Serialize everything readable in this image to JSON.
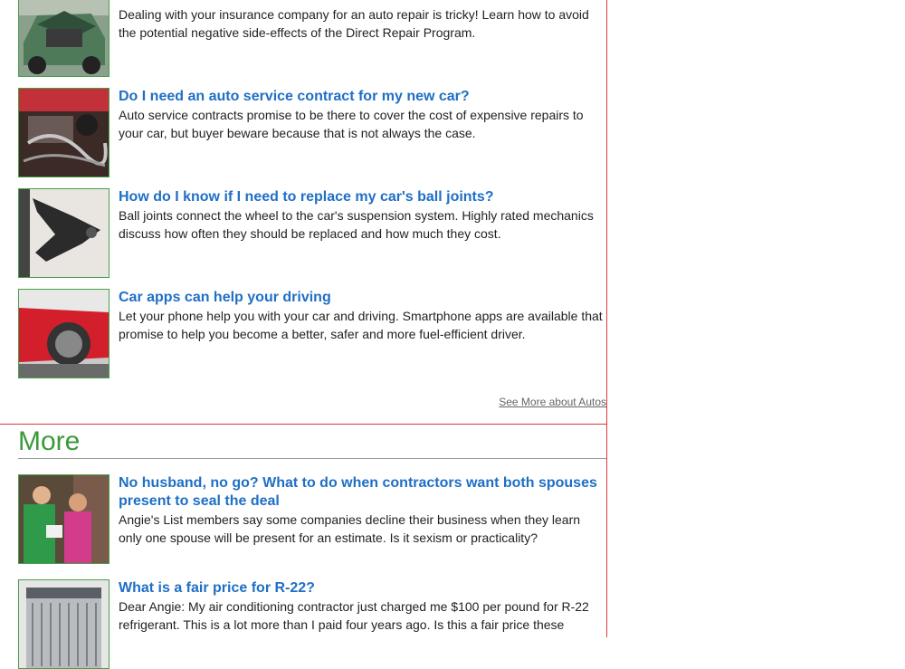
{
  "articles_top": [
    {
      "title": "",
      "description": "Dealing with your insurance company for an auto repair is tricky! Learn how to avoid the potential negative side-effects of the Direct Repair Program.",
      "image_icon": "damaged-car-photo"
    },
    {
      "title": "Do I need an auto service contract for my new car?",
      "description": "Auto service contracts promise to be there to cover the cost of expensive repairs to your car, but buyer beware because that is not always the case.",
      "image_icon": "car-engine-photo"
    },
    {
      "title": "How do I know if I need to replace my car's ball joints?",
      "description": "Ball joints connect the wheel to the car's suspension system. Highly rated mechanics discuss how often they should be replaced and how much they cost.",
      "image_icon": "ball-joint-photo"
    },
    {
      "title": "Car apps can help your driving",
      "description": "Let your phone help you with your car and driving. Smartphone apps are available that promise to help you become a better, safer and more fuel-efficient driver.",
      "image_icon": "red-car-photo"
    }
  ],
  "see_more_label": "See More about Autos",
  "more_section": {
    "heading": "More",
    "articles": [
      {
        "title": "No husband, no go? What to do when contractors want both spouses present to seal the deal",
        "description": "Angie's List members say some companies decline their business when they learn only one spouse will be present for an estimate. Is it sexism or practicality?",
        "image_icon": "contractor-and-homeowner-photo"
      },
      {
        "title": "What is a fair price for R-22?",
        "description": "Dear Angie: My air conditioning contractor just charged me $100 per pound for R-22 refrigerant. This is a lot more than I paid four years ago. Is this a fair price these",
        "image_icon": "ac-unit-photo"
      }
    ]
  },
  "colors": {
    "title_link": "#1f6fc5",
    "thumb_border": "#46a046",
    "section_heading": "#3a9a3a",
    "column_border": "#d93a3a"
  }
}
